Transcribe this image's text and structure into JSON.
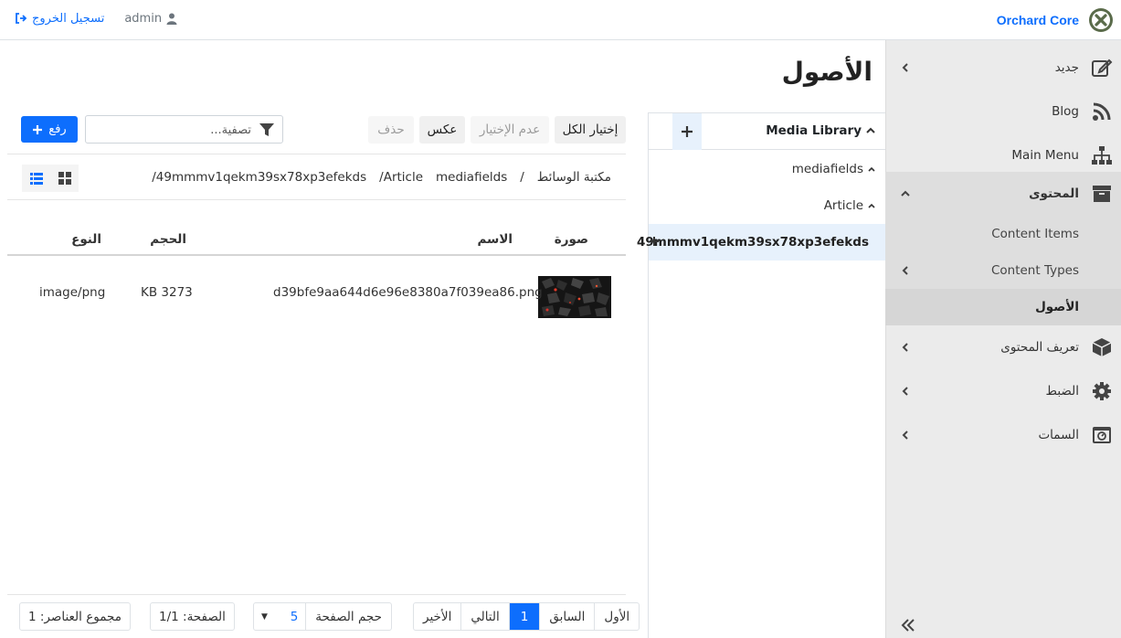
{
  "brand": {
    "name": "Orchard Core"
  },
  "user": {
    "name": "admin",
    "logout_label": "تسجيل الخروج"
  },
  "sidebar": {
    "items": [
      {
        "label": "جديد",
        "icon": "edit-icon"
      },
      {
        "label": "Blog",
        "icon": "rss-icon"
      },
      {
        "label": "Main Menu",
        "icon": "sitemap-icon"
      },
      {
        "label": "المحتوى",
        "icon": "archive-icon"
      },
      {
        "label": "تعريف المحتوى",
        "icon": "cube-icon"
      },
      {
        "label": "الضبط",
        "icon": "gear-icon"
      },
      {
        "label": "السمات",
        "icon": "theme-icon"
      }
    ],
    "content_sub": [
      {
        "label": "Content Items"
      },
      {
        "label": "Content Types"
      },
      {
        "label": "الأصول"
      }
    ]
  },
  "page": {
    "title": "الأصول"
  },
  "tree": {
    "root": "Media Library",
    "nodes": [
      {
        "label": "mediafields"
      },
      {
        "label": "Article"
      },
      {
        "label": "49mmmv1qekm39sx78xp3efekds"
      }
    ]
  },
  "toolbar": {
    "select_all": "إختيار الكل",
    "unselect": "عدم الإختيار",
    "invert": "عكس",
    "delete": "حذف",
    "filter_placeholder": "تصفية...",
    "upload": "رفع"
  },
  "breadcrumb": [
    "مكتبة الوسائط",
    "/",
    "mediafields",
    "/Article",
    "/49mmmv1qekm39sx78xp3efekds"
  ],
  "table": {
    "headers": {
      "image": "صورة",
      "name": "الاسم",
      "size": "الحجم",
      "type": "النوع"
    },
    "rows": [
      {
        "name": "d39bfe9aa644d6e96e8380a7f039ea86.png",
        "size": "KB 3273",
        "type": "image/png"
      }
    ]
  },
  "pager": {
    "first": "الأول",
    "previous": "السابق",
    "current": "1",
    "next": "التالي",
    "last": "الأخير",
    "page_size_label": "حجم الصفحة",
    "page_size_value": "5",
    "page_info": "الصفحة: 1/1",
    "total_info": "مجموع العناصر: 1"
  },
  "colors": {
    "primary": "#0d6efd",
    "sidebar_bg": "#ebebeb",
    "selected_bg": "#e7f1fc"
  }
}
